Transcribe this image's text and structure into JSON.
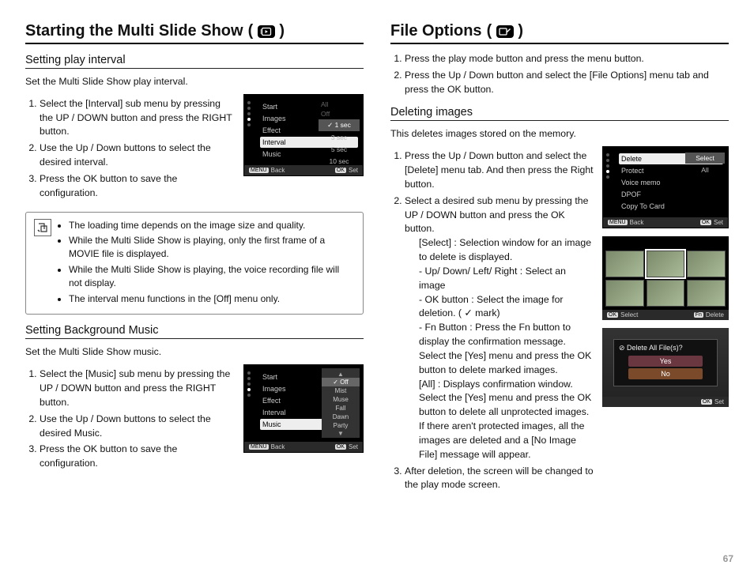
{
  "pageNumber": "67",
  "left": {
    "title": "Starting the Multi Slide Show",
    "sub1": {
      "heading": "Setting play interval",
      "desc": "Set the Multi Slide Show play interval.",
      "steps": [
        "Select the [Interval] sub menu by pressing the UP / DOWN button and press the RIGHT button.",
        "Use the Up / Down buttons to select the desired interval.",
        "Press the OK button to save the configuration."
      ]
    },
    "lcd1": {
      "menu": [
        "Start",
        "Images",
        "Effect",
        "Interval",
        "Music"
      ],
      "activeIndex": 3,
      "grayTop": [
        "All",
        "Off"
      ],
      "options": [
        "1 sec",
        "3 sec",
        "5 sec",
        "10 sec"
      ],
      "optSelected": 0,
      "footLeft": "Back",
      "footLeftBtn": "MENU",
      "footRight": "Set",
      "footRightBtn": "OK"
    },
    "notes": [
      "The loading time depends on the image size and quality.",
      "While the Multi Slide Show is playing, only the first frame of a MOVIE file is displayed.",
      "While the Multi Slide Show is playing, the voice recording file will not display.",
      "The interval menu functions in the [Off] menu only."
    ],
    "sub2": {
      "heading": "Setting Background Music",
      "desc": "Set the Multi Slide Show music.",
      "steps": [
        "Select the [Music] sub menu by pressing the UP / DOWN button and press the RIGHT button.",
        "Use the Up / Down buttons to select the desired Music.",
        "Press the OK button to save the configuration."
      ]
    },
    "lcd2": {
      "menu": [
        "Start",
        "Images",
        "Effect",
        "Interval",
        "Music"
      ],
      "activeIndex": 4,
      "musicOptions": [
        "Off",
        "Mist",
        "Muse",
        "Fall",
        "Dawn",
        "Party"
      ],
      "musicSelected": 0,
      "footLeft": "Back",
      "footLeftBtn": "MENU",
      "footRight": "Set",
      "footRightBtn": "OK"
    }
  },
  "right": {
    "title": "File Options",
    "introSteps": [
      "Press the play mode button and press the menu button.",
      "Press the Up / Down button and select the [File Options] menu tab and press the OK button."
    ],
    "sub1": {
      "heading": "Deleting images",
      "desc": "This deletes images stored on the memory.",
      "step1": "Press the Up / Down button and select the [Delete] menu tab. And then press the Right button.",
      "step2": "Select a desired sub menu by pressing the UP / DOWN button and press the OK button.",
      "selectLine": "[Select] : Selection window for an image to delete is displayed.",
      "selectBullets": [
        "Up/ Down/ Left/ Right : Select an image",
        "OK button : Select the image for deletion. ( ✓ mark)",
        "Fn Button : Press the Fn button to display the confirmation message. Select the [Yes] menu and press the OK button to delete marked images."
      ],
      "allLine": "[All] : Displays confirmation window. Select the [Yes] menu and press the OK button to delete all unprotected images. If there aren't protected images, all the images are deleted and a [No Image File] message will appear.",
      "step3": "After deletion, the screen will be changed to the play mode screen."
    },
    "lcdA": {
      "menu": [
        "Delete",
        "Protect",
        "Voice memo",
        "DPOF",
        "Copy To Card"
      ],
      "activeIndex": 0,
      "opts": [
        "Select",
        "All"
      ],
      "optSelected": 0,
      "footLeft": "Back",
      "footLeftBtn": "MENU",
      "footRight": "Set",
      "footRightBtn": "OK"
    },
    "lcdB": {
      "footLeft": "Select",
      "footLeftBtn": "OK",
      "footRight": "Delete",
      "footRightBtn": "Fn"
    },
    "lcdC": {
      "dialogTitle": "Delete All File(s)?",
      "yes": "Yes",
      "no": "No",
      "footRight": "Set",
      "footRightBtn": "OK"
    }
  }
}
